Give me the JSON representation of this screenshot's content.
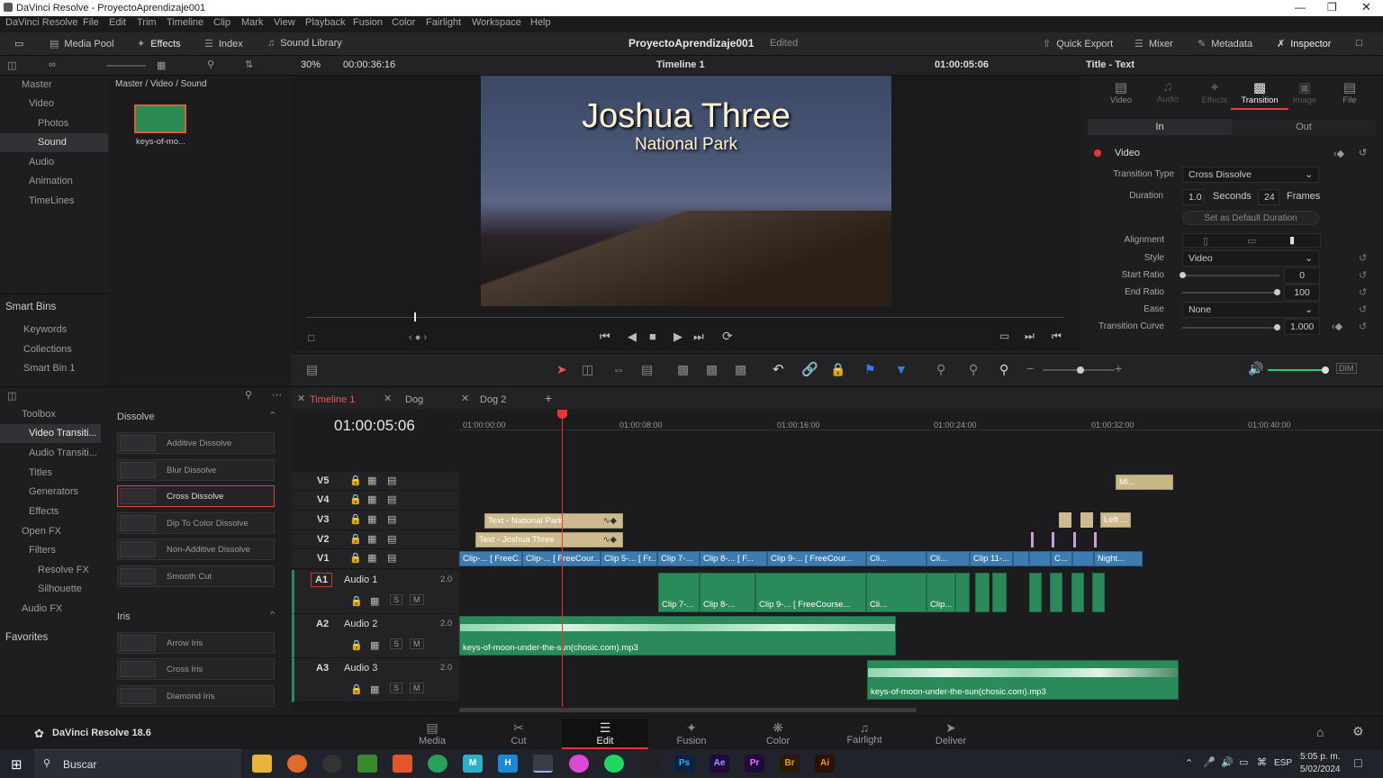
{
  "window": {
    "title": "DaVinci Resolve - ProyectoAprendizaje001"
  },
  "menu": [
    "DaVinci Resolve",
    "File",
    "Edit",
    "Trim",
    "Timeline",
    "Clip",
    "Mark",
    "View",
    "Playback",
    "Fusion",
    "Color",
    "Fairlight",
    "Workspace",
    "Help"
  ],
  "toolbar": {
    "media_pool": "Media Pool",
    "effects": "Effects",
    "index": "Index",
    "sound_library": "Sound Library",
    "project_name": "ProyectoAprendizaje001",
    "project_status": "Edited",
    "quick_export": "Quick Export",
    "mixer": "Mixer",
    "metadata": "Metadata",
    "inspector": "Inspector"
  },
  "viewer": {
    "zoom": "30%",
    "duration": "00:00:36:16",
    "timeline_name": "Timeline 1",
    "timecode": "01:00:05:06",
    "title_main": "Joshua Three",
    "title_sub": "National Park"
  },
  "bins": {
    "breadcrumb": "Master / Video / Sound",
    "tree": [
      "Master",
      "Video",
      "Photos",
      "Sound",
      "Audio",
      "Animation",
      "TimeLines"
    ],
    "clip_name": "keys-of-mo...",
    "smart_bins_title": "Smart Bins",
    "smart_bins": [
      "Keywords",
      "Collections",
      "Smart Bin 1"
    ]
  },
  "toolbox": {
    "tree": [
      "Toolbox",
      "Video Transiti...",
      "Audio Transiti...",
      "Titles",
      "Generators",
      "Effects",
      "Open FX",
      "Filters",
      "Resolve FX",
      "Silhouette",
      "Audio FX"
    ],
    "favorites": "Favorites",
    "dissolve_header": "Dissolve",
    "dissolve_items": [
      "Additive Dissolve",
      "Blur Dissolve",
      "Cross Dissolve",
      "Dip To Color Dissolve",
      "Non-Additive Dissolve",
      "Smooth Cut"
    ],
    "iris_header": "Iris",
    "iris_items": [
      "Arrow Iris",
      "Cross Iris",
      "Diamond Iris"
    ]
  },
  "inspector": {
    "title": "Title - Text",
    "tabs": [
      "Video",
      "Audio",
      "Effects",
      "Transition",
      "Image",
      "File"
    ],
    "in_label": "In",
    "out_label": "Out",
    "section": "Video",
    "transition_type_label": "Transition Type",
    "transition_type": "Cross Dissolve",
    "duration_label": "Duration",
    "duration_seconds": "1.0",
    "seconds_label": "Seconds",
    "duration_frames": "24",
    "frames_label": "Frames",
    "default_button": "Set as Default Duration",
    "alignment_label": "Alignment",
    "style_label": "Style",
    "style": "Video",
    "start_ratio_label": "Start Ratio",
    "start_ratio": "0",
    "end_ratio_label": "End Ratio",
    "end_ratio": "100",
    "ease_label": "Ease",
    "ease": "None",
    "curve_label": "Transition Curve",
    "curve": "1.000"
  },
  "timeline": {
    "tabs": [
      "Timeline 1",
      "Dog",
      "Dog 2"
    ],
    "timecode": "01:00:05:06",
    "ruler": [
      "01:00:00:00",
      "01:00:08:00",
      "01:00:16:00",
      "01:00:24:00",
      "01:00:32:00",
      "01:00:40:00"
    ],
    "video_tracks": [
      "V5",
      "V4",
      "V3",
      "V2",
      "V1"
    ],
    "audio_tracks": [
      {
        "id": "A1",
        "name": "Audio 1",
        "ch": "2.0"
      },
      {
        "id": "A2",
        "name": "Audio 2",
        "ch": "2.0"
      },
      {
        "id": "A3",
        "name": "Audio 3",
        "ch": "2.0"
      }
    ],
    "v3_clip": "Text - National Park",
    "v2_clip": "Text - Joshua Three",
    "v3_right": "Left ...",
    "v5_clip": "Mi...",
    "v1_clips": [
      "Clip-... [ FreeC...",
      "Clip-... [ FreeCour...",
      "Clip 5-... [ Fr...",
      "Clip 7-...",
      "Clip 8-... [ F...",
      "Clip 9-... [ FreeCour...",
      "Cli...",
      "Cli...",
      "Clip 11-...",
      "C...",
      "Night..."
    ],
    "a1_clips": [
      "Clip 7-...",
      "Clip 8-...",
      "Clip 9-... [ FreeCourse...",
      "Cli...",
      "Clip..."
    ],
    "a2_clip": "keys-of-moon-under-the-sun(chosic.com).mp3",
    "a3_clip": "keys-of-moon-under-the-sun(chosic.com).mp3"
  },
  "pages": {
    "app": "DaVinci Resolve 18.6",
    "tabs": [
      "Media",
      "Cut",
      "Edit",
      "Fusion",
      "Color",
      "Fairlight",
      "Deliver"
    ]
  },
  "taskbar": {
    "search": "Buscar",
    "lang": "ESP",
    "time": "5:05 p. m.",
    "date": "5/02/2024"
  }
}
